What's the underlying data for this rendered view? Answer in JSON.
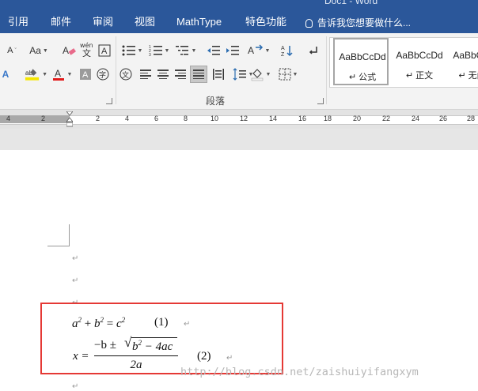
{
  "window": {
    "title_fragment": "Doc1 - Word"
  },
  "menu": [
    {
      "label": "引用",
      "active": false
    },
    {
      "label": "邮件",
      "active": false
    },
    {
      "label": "审阅",
      "active": false
    },
    {
      "label": "视图",
      "active": false
    },
    {
      "label": "MathType",
      "active": false
    },
    {
      "label": "特色功能",
      "active": false
    }
  ],
  "tell_me": {
    "placeholder": "告诉我您想要做什么..."
  },
  "ribbon": {
    "font_group": {
      "font_size_menu": "Aa",
      "phonetic_guide": "wén"
    },
    "paragraph_group": {
      "label": "段落"
    },
    "styles": [
      {
        "sample": "AaBbCcDd",
        "name": "↵ 公式",
        "selected": true
      },
      {
        "sample": "AaBbCcDd",
        "name": "↵ 正文",
        "selected": false
      },
      {
        "sample": "AaBbCcDd",
        "name": "↵ 无间隔",
        "selected": false
      }
    ]
  },
  "ruler": {
    "numbers": [
      "4",
      "2",
      "2",
      "4",
      "6",
      "8",
      "10",
      "12",
      "14",
      "16",
      "18",
      "20",
      "22",
      "24",
      "26",
      "28"
    ]
  },
  "document": {
    "para_mark": "↵",
    "equation1": {
      "a": "a",
      "b": "b",
      "c": "c",
      "exp": "2",
      "number": "(1)"
    },
    "equation2": {
      "lhs": "x =",
      "numerator_prefix": "−b ±",
      "radicand_b": "b",
      "radicand_exp": "2",
      "radicand_rest": " − 4ac",
      "denominator": "2a",
      "number": "(2)"
    },
    "watermark": "http://blog.csdn.net/zaishuiyifangxym"
  },
  "colors": {
    "title_bar": "#2b579a",
    "ribbon": "#f3f3f3",
    "highlight_frame": "#e53935"
  }
}
